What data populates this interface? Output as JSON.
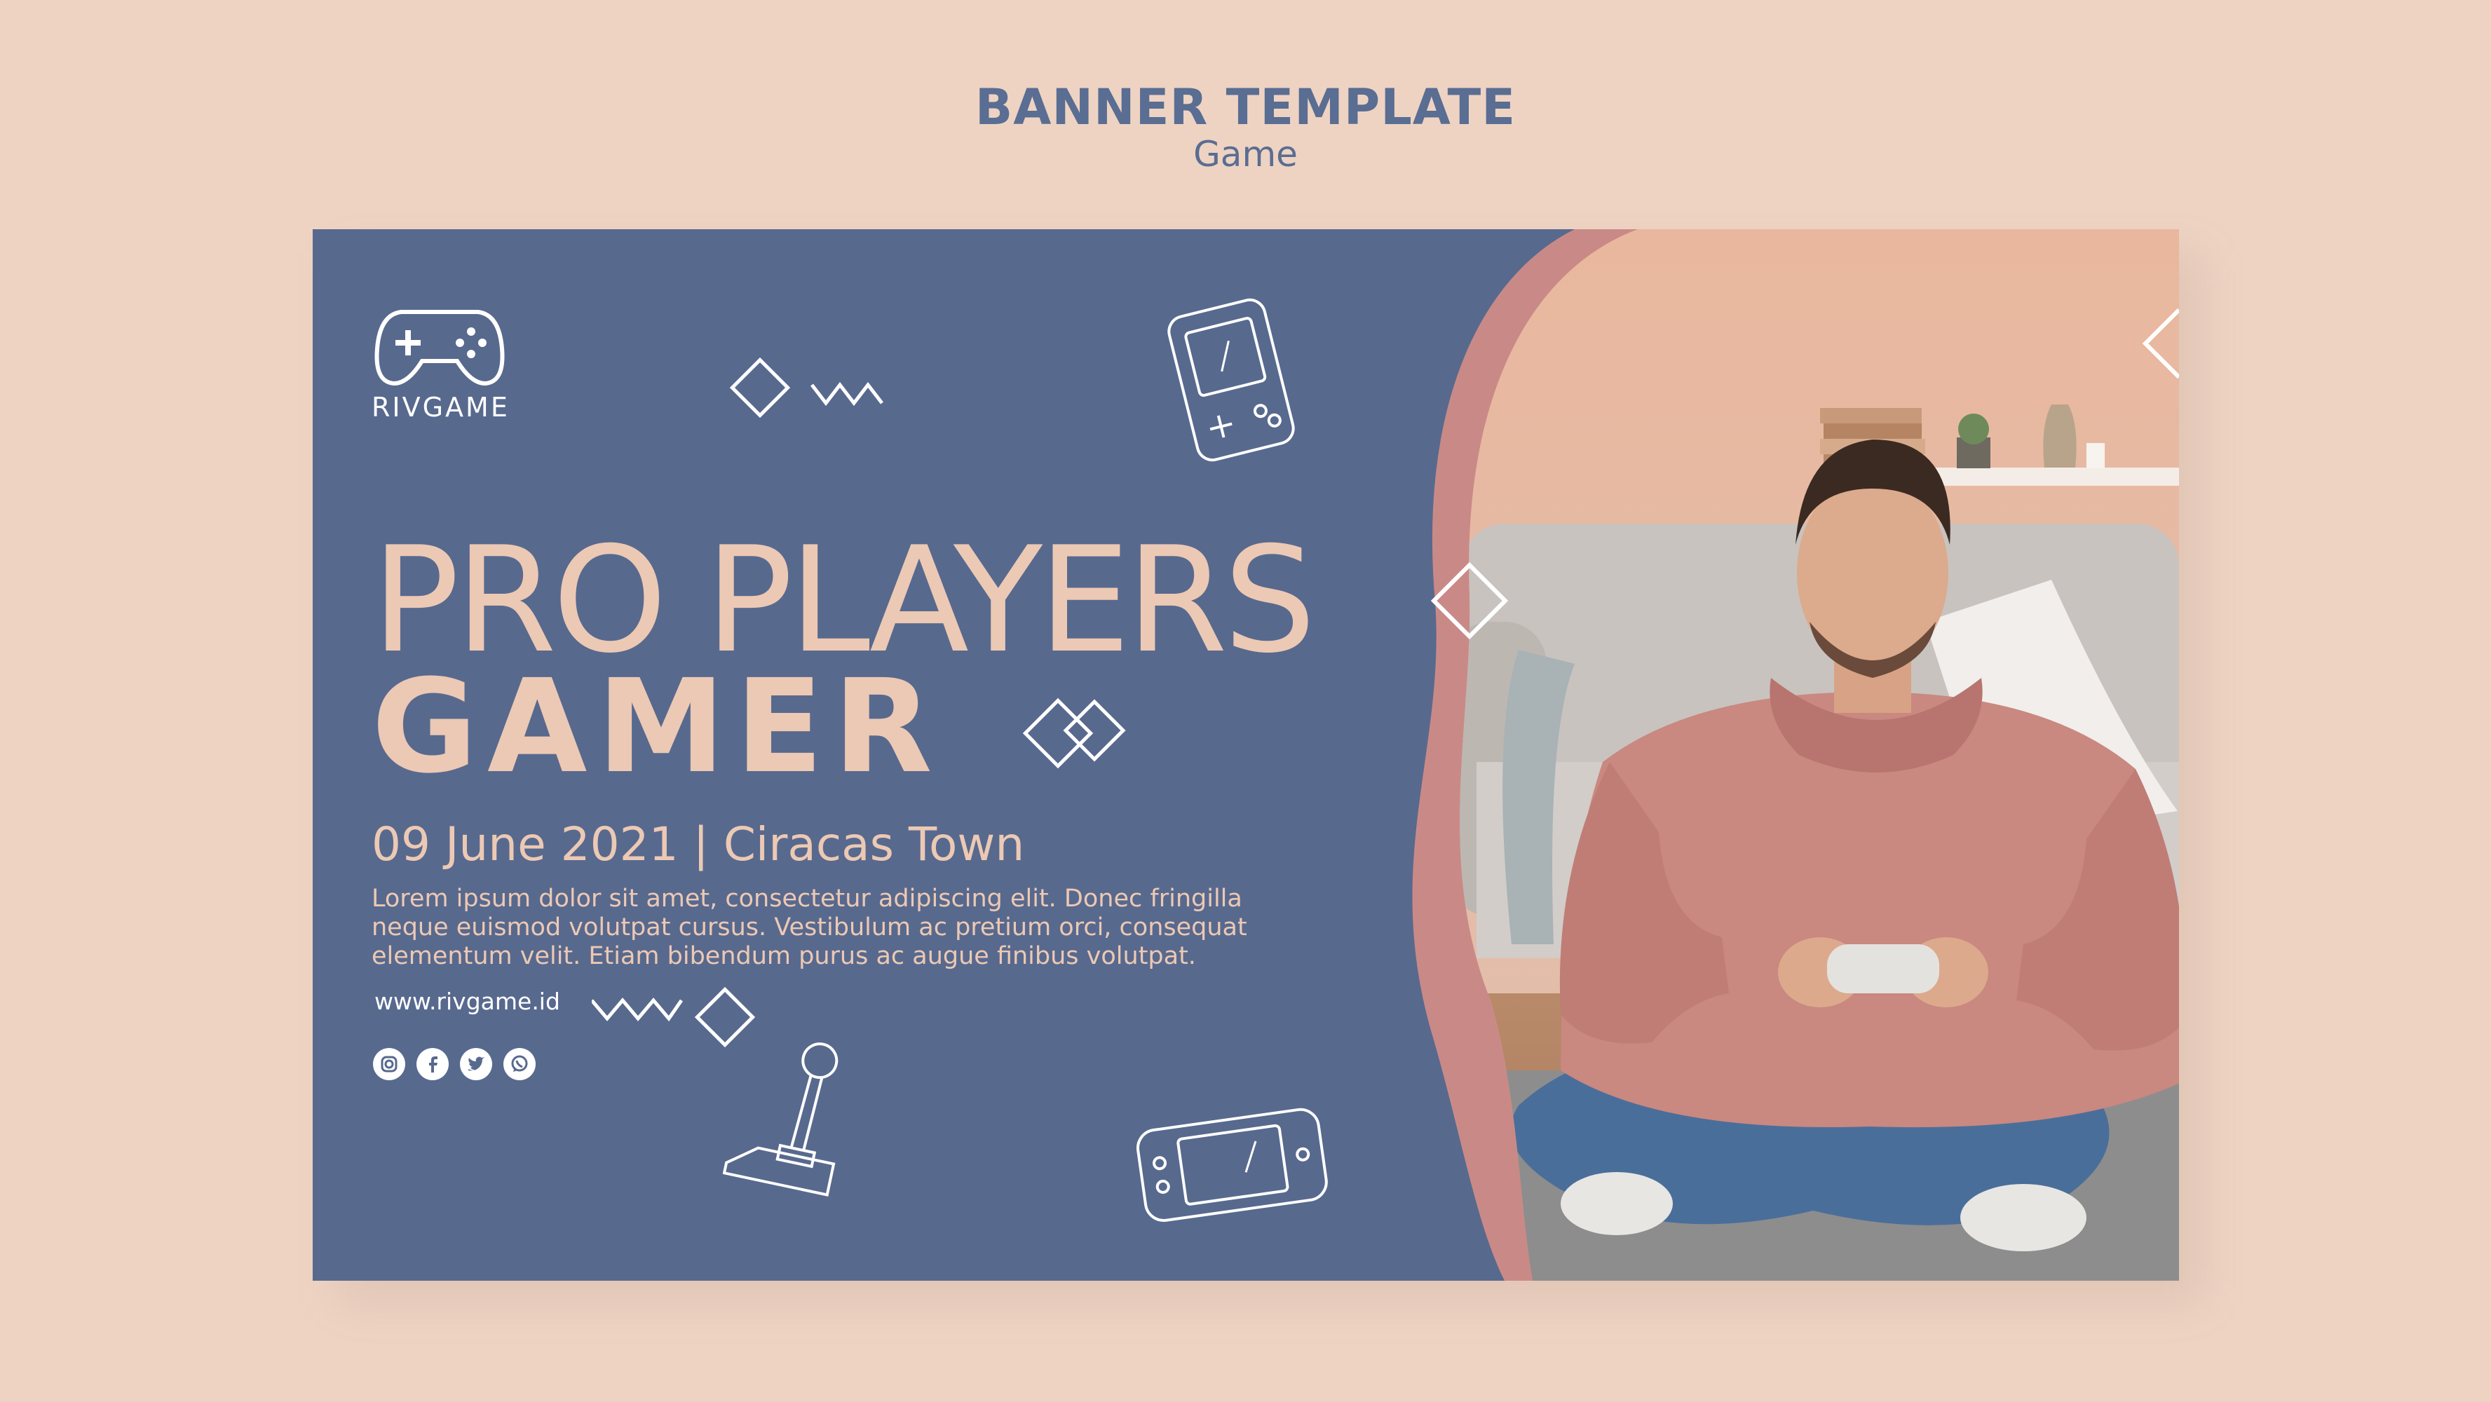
{
  "header": {
    "title": "BANNER TEMPLATE",
    "subtitle": "Game"
  },
  "banner": {
    "brand": "RIVGAME",
    "headline_line1": "PRO PLAYERS",
    "headline_line2": "GAMER",
    "event_line": "09 June 2021 | Ciracas Town",
    "body_lines": [
      "Lorem ipsum dolor sit amet, consectetur adipiscing elit. Donec fringilla",
      "neque euismod volutpat cursus. Vestibulum ac pretium orci, consequat",
      "elementum velit. Etiam bibendum purus ac augue finibus volutpat."
    ],
    "website": "www.rivgame.id",
    "social_icons": [
      "instagram-icon",
      "facebook-icon",
      "twitter-icon",
      "whatsapp-icon"
    ]
  },
  "colors": {
    "page_background": "#eed3c3",
    "banner_blue": "#58698e",
    "accent_peach": "#ecc9b4",
    "accent_rose": "#c98a87",
    "header_text": "#5a6d92"
  }
}
